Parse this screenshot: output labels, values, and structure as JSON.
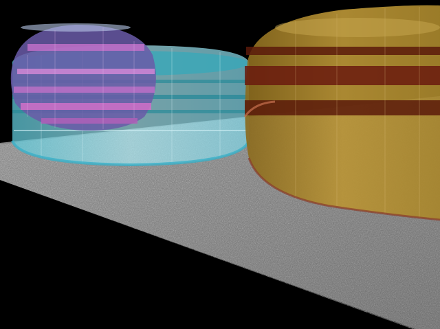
{
  "scene": {
    "description_visible_text": "",
    "colors": {
      "background": "#000000",
      "floor_light": "#9a9a9a",
      "floor_dark": "#5a5a5a",
      "cyan_volume": "#6fd6e6",
      "purple_volume": "#6a5aa8",
      "pink_band": "#d070c8",
      "gold_volume": "#b8902a",
      "dark_red_band": "#6a1a0e"
    }
  }
}
